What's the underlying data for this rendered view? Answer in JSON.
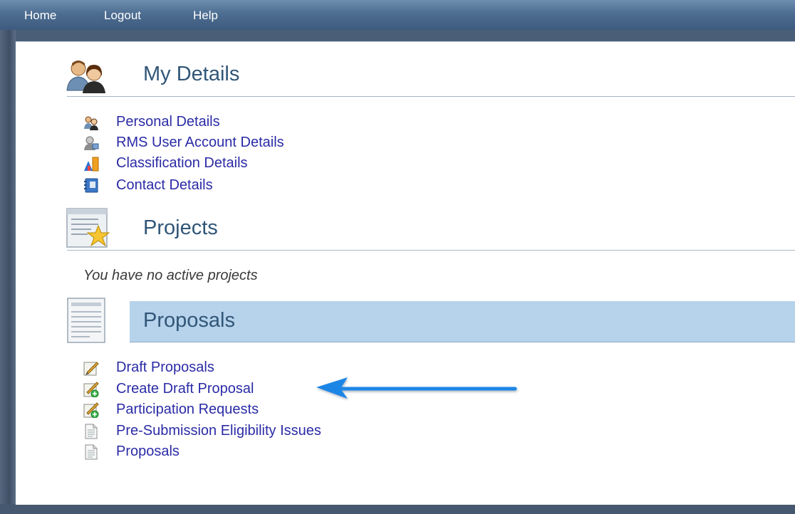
{
  "nav": {
    "home_label": "Home",
    "logout_label": "Logout",
    "help_label": "Help"
  },
  "my_details": {
    "title": "My Details",
    "links": [
      {
        "label": "Personal Details",
        "icon": "users-icon"
      },
      {
        "label": "RMS User Account Details",
        "icon": "user-account-icon"
      },
      {
        "label": "Classification Details",
        "icon": "classification-chart-icon"
      },
      {
        "label": "Contact Details",
        "icon": "address-book-icon"
      }
    ]
  },
  "projects": {
    "title": "Projects",
    "empty_message": "You have no active projects"
  },
  "proposals": {
    "title": "Proposals",
    "links": [
      {
        "label": "Draft Proposals",
        "icon": "pencil-icon"
      },
      {
        "label": "Create Draft Proposal",
        "icon": "pencil-add-icon"
      },
      {
        "label": "Participation Requests",
        "icon": "pencil-add-icon"
      },
      {
        "label": "Pre-Submission Eligibility Issues",
        "icon": "document-icon"
      },
      {
        "label": "Proposals",
        "icon": "document-icon"
      }
    ]
  },
  "colors": {
    "nav_bar": "#4d6d91",
    "section_title": "#315678",
    "link": "#2b2ba7",
    "highlight_band": "#b7d3eb",
    "annotation_arrow": "#1f86e6"
  }
}
